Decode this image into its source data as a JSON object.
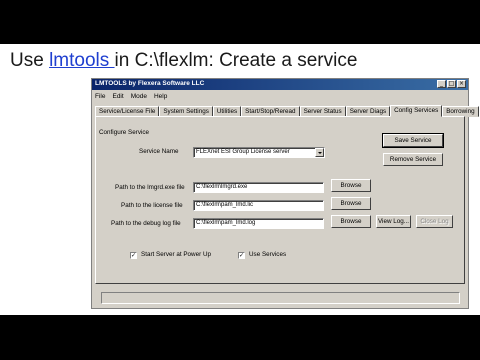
{
  "slide": {
    "title_prefix": "Use ",
    "title_link": "lmtools ",
    "title_suffix": "in C:\\flexlm: Create a service"
  },
  "window": {
    "title": "LMTOOLS by Flexera Software LLC",
    "controls": [
      "_",
      "□",
      "×"
    ],
    "menu": [
      "File",
      "Edit",
      "Mode",
      "Help"
    ],
    "tabs": [
      "Service/License File",
      "System Settings",
      "Utilities",
      "Start/Stop/Reread",
      "Server Status",
      "Server Diags",
      "Config Services",
      "Borrowing"
    ],
    "active_tab": "Config Services"
  },
  "config": {
    "section_label": "Configure Service",
    "service_name_label": "Service Name",
    "service_name_value": "FLEXnet ESI Group License server",
    "save_button": "Save Service",
    "remove_button": "Remove Service",
    "lmgrd_label": "Path to the lmgrd.exe file",
    "lmgrd_value": "C:\\flexlm\\lmgrd.exe",
    "license_label": "Path to the license file",
    "license_value": "C:\\flexlm\\pam_lmd.lic",
    "debug_label": "Path to the debug log file",
    "debug_value": "C:\\flexlm\\pam_lmd.log",
    "browse_label": "Browse",
    "view_log_button": "View Log...",
    "close_log_button": "Close Log",
    "start_power_up_label": "Start Server at Power Up",
    "start_power_up_checked": "✓",
    "use_services_label": "Use Services",
    "use_services_checked": "✓"
  }
}
